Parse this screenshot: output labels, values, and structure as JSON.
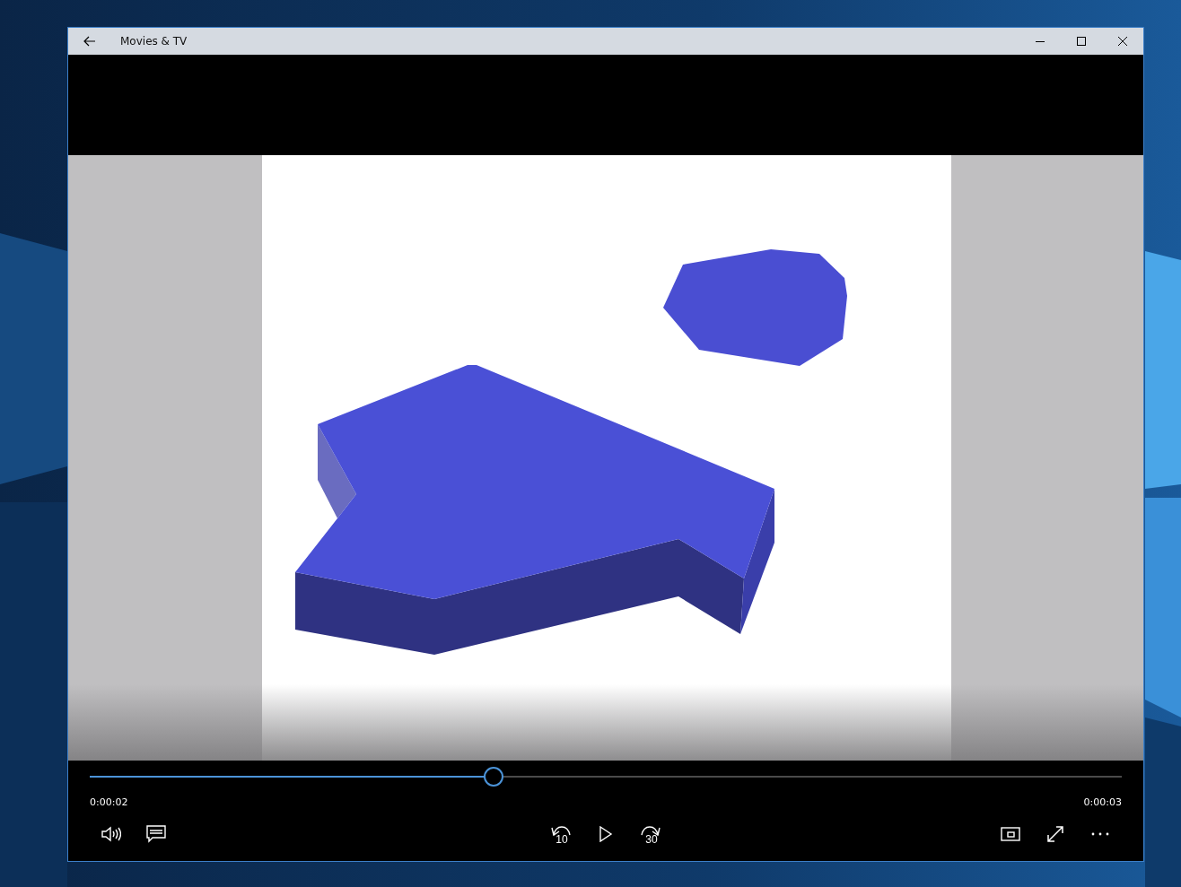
{
  "window": {
    "title": "Movies & TV"
  },
  "player": {
    "progress": {
      "level": 0.39
    },
    "elapsed": "0:00:02",
    "remaining": "0:00:03",
    "skip_back": "10",
    "skip_forward": "30"
  }
}
